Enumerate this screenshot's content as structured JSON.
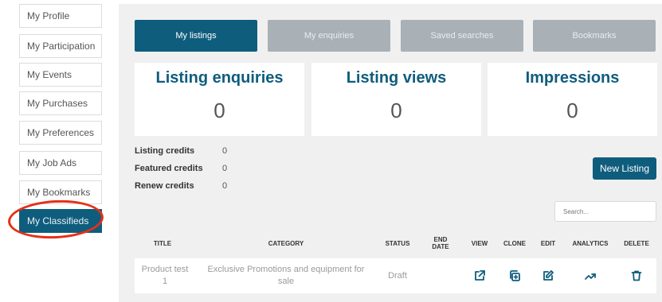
{
  "sidebar": {
    "items": [
      {
        "label": "My Profile"
      },
      {
        "label": "My Participation"
      },
      {
        "label": "My Events"
      },
      {
        "label": "My Purchases"
      },
      {
        "label": "My Preferences"
      },
      {
        "label": "My Job Ads"
      },
      {
        "label": "My Bookmarks"
      },
      {
        "label": "My Classifieds",
        "active": true
      }
    ]
  },
  "tabs": [
    {
      "label": "My listings",
      "active": true
    },
    {
      "label": "My enquiries"
    },
    {
      "label": "Saved searches"
    },
    {
      "label": "Bookmarks"
    }
  ],
  "stats": [
    {
      "title": "Listing enquiries",
      "value": "0"
    },
    {
      "title": "Listing views",
      "value": "0"
    },
    {
      "title": "Impressions",
      "value": "0"
    }
  ],
  "credits": [
    {
      "label": "Listing credits",
      "value": "0"
    },
    {
      "label": "Featured credits",
      "value": "0"
    },
    {
      "label": "Renew credits",
      "value": "0"
    }
  ],
  "new_listing_label": "New Listing",
  "search": {
    "placeholder": "Search..."
  },
  "table": {
    "headers": [
      "TITLE",
      "CATEGORY",
      "STATUS",
      "END DATE",
      "VIEW",
      "CLONE",
      "EDIT",
      "ANALYTICS",
      "DELETE"
    ],
    "rows": [
      {
        "title": "Product test 1",
        "category": "Exclusive Promotions and equipment for sale",
        "status": "Draft",
        "end_date": "",
        "icons": [
          "external-link-icon",
          "clone-icon",
          "edit-icon",
          "trending-up-icon",
          "trash-icon"
        ]
      }
    ]
  },
  "colors": {
    "accent": "#0f5d7d",
    "tab_inactive": "#a9b0b6",
    "annotation": "#e53018"
  }
}
